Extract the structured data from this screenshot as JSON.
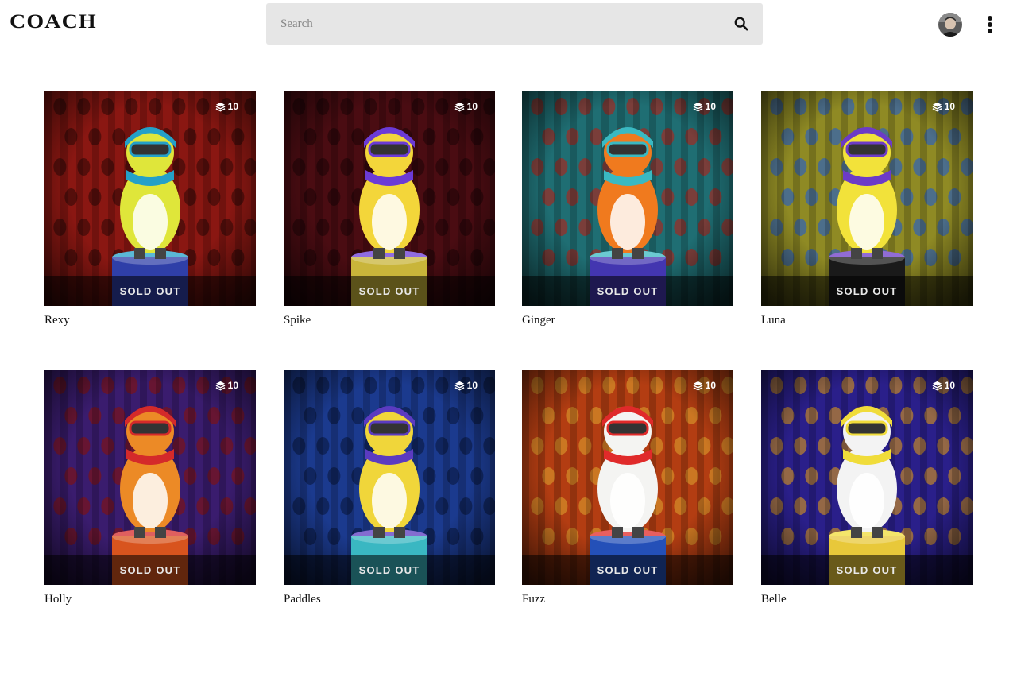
{
  "header": {
    "brand": "COACH",
    "search_placeholder": "Search"
  },
  "cards": [
    {
      "name": "Rexy",
      "edition_count": "10",
      "status": "SOLD OUT",
      "bg": "#8a1712",
      "pattern": "#3f0b08",
      "body": "#dfe63a",
      "accent": "#24a0c8",
      "base": "#2f3fa8"
    },
    {
      "name": "Spike",
      "edition_count": "10",
      "status": "SOLD OUT",
      "bg": "#4a0c12",
      "pattern": "#250508",
      "body": "#f3d63a",
      "accent": "#6b3bd6",
      "base": "#c9b53a"
    },
    {
      "name": "Ginger",
      "edition_count": "10",
      "status": "SOLD OUT",
      "bg": "#1f6e73",
      "pattern": "#a12a22",
      "body": "#f07a1e",
      "accent": "#3ab9c2",
      "base": "#4336b0"
    },
    {
      "name": "Luna",
      "edition_count": "10",
      "status": "SOLD OUT",
      "bg": "#8f8a24",
      "pattern": "#2f62b8",
      "body": "#f2e23a",
      "accent": "#6c3bc7",
      "base": "#1a1a1a"
    },
    {
      "name": "Holly",
      "edition_count": "10",
      "status": "SOLD OUT",
      "bg": "#3a1c6e",
      "pattern": "#7a1218",
      "body": "#ec8a26",
      "accent": "#d42a2a",
      "base": "#d8541e"
    },
    {
      "name": "Paddles",
      "edition_count": "10",
      "status": "SOLD OUT",
      "bg": "#1b3a8e",
      "pattern": "#0c1d4a",
      "body": "#f0d63a",
      "accent": "#5b3bc0",
      "base": "#3ab7c2"
    },
    {
      "name": "Fuzz",
      "edition_count": "10",
      "status": "SOLD OUT",
      "bg": "#b33d12",
      "pattern": "#d6902a",
      "body": "#f4f4f2",
      "accent": "#e02a2a",
      "base": "#2450b8"
    },
    {
      "name": "Belle",
      "edition_count": "10",
      "status": "SOLD OUT",
      "bg": "#2a1f8a",
      "pattern": "#c2882a",
      "body": "#f3f3f3",
      "accent": "#f0dc3a",
      "base": "#e8c83a"
    }
  ]
}
